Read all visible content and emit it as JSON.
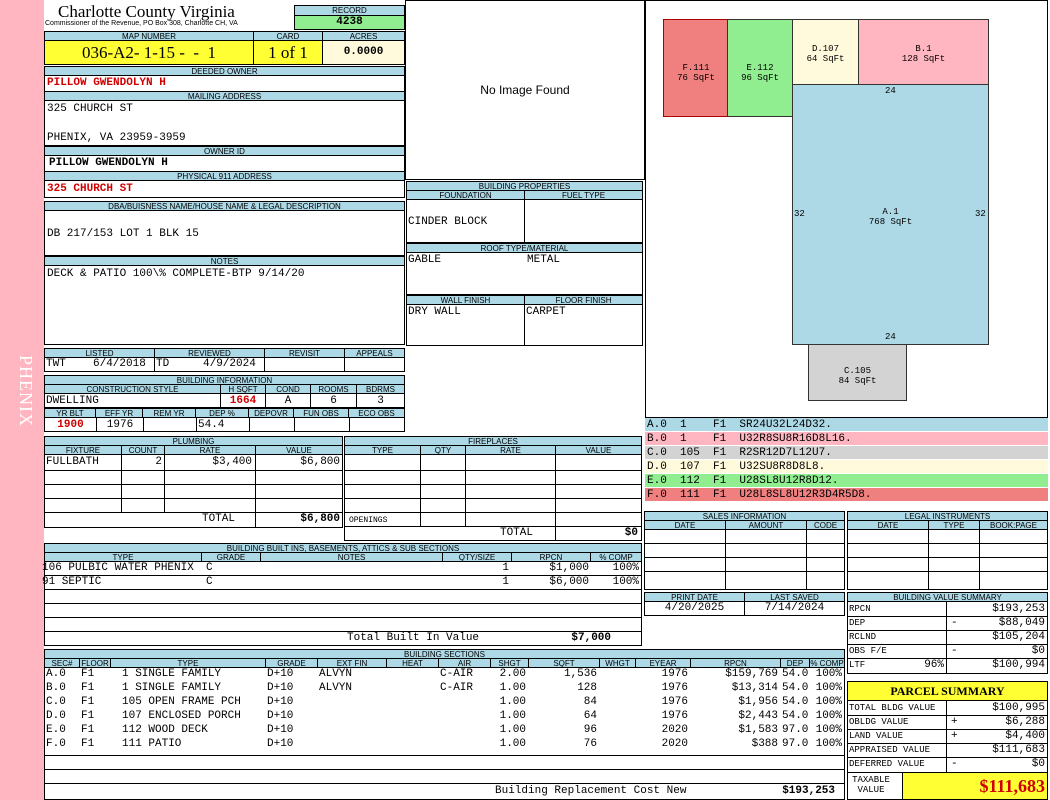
{
  "side_tab": "PHENIX",
  "county": {
    "title": "Charlotte County Virginia",
    "subtitle": "Commissioner of the Revenue, PO Box 308, Charlotte CH, VA"
  },
  "record": {
    "label": "RECORD",
    "value": "4238"
  },
  "map_number": {
    "label": "MAP NUMBER",
    "value": "036-A2- 1-15 -  -  1"
  },
  "card": {
    "label": "CARD",
    "value": "1 of 1"
  },
  "acres": {
    "label": "ACRES",
    "value": "0.0000"
  },
  "deeded_owner": {
    "label": "DEEDED OWNER",
    "value": "PILLOW GWENDOLYN H"
  },
  "mailing_address": {
    "label": "MAILING ADDRESS",
    "line1": "325 CHURCH ST",
    "line2": "PHENIX, VA 23959-3959"
  },
  "owner_id": {
    "label": "OWNER ID",
    "value": "PILLOW GWENDOLYN H"
  },
  "physical_address": {
    "label": "PHYSICAL 911 ADDRESS",
    "value": "325 CHURCH ST"
  },
  "dba": {
    "label": "DBA/BUISNESS NAME/HOUSE NAME & LEGAL DESCRIPTION",
    "value": "DB 217/153 LOT 1 BLK 15"
  },
  "notes": {
    "label": "NOTES",
    "value": "DECK & PATIO 100\\% COMPLETE-BTP 9/14/20"
  },
  "photo": {
    "text": "No Image Found"
  },
  "building_properties": {
    "label": "BUILDING PROPERTIES",
    "foundation_label": "FOUNDATION",
    "foundation": "CINDER BLOCK",
    "fuel_label": "FUEL TYPE",
    "fuel": "",
    "roof_label": "ROOF TYPE/MATERIAL",
    "roof_type": "GABLE",
    "roof_material": "METAL",
    "wall_label": "WALL FINISH",
    "wall": "DRY WALL",
    "floor_label": "FLOOR FINISH",
    "floor": "CARPET"
  },
  "review": {
    "listed_label": "LISTED",
    "listed_by": "TWT",
    "listed_date": "6/4/2018",
    "reviewed_label": "REVIEWED",
    "reviewed_by": "TD",
    "reviewed_date": "4/9/2024",
    "revisit_label": "REVISIT",
    "appeals_label": "APPEALS"
  },
  "building_info": {
    "label": "BUILDING INFORMATION",
    "headers": [
      "CONSTRUCTION STYLE",
      "H SQFT",
      "COND",
      "ROOMS",
      "BDRMS"
    ],
    "style": "DWELLING",
    "hsqft": "1664",
    "cond": "A",
    "rooms": "6",
    "bdrms": "3",
    "headers2": [
      "YR BLT",
      "EFF YR",
      "REM YR",
      "DEP %",
      "DEPOVR",
      "FUN OBS",
      "ECO OBS"
    ],
    "yr_blt": "1900",
    "eff_yr": "1976",
    "rem_yr": "",
    "dep": "54.4",
    "depovr": "",
    "fun_obs": "",
    "eco_obs": ""
  },
  "plumbing": {
    "label": "PLUMBING",
    "headers": [
      "FIXTURE",
      "COUNT",
      "RATE",
      "VALUE"
    ],
    "rows": [
      [
        "FULLBATH",
        "2",
        "$3,400",
        "$6,800"
      ]
    ],
    "total_label": "TOTAL",
    "total": "$6,800"
  },
  "fireplaces": {
    "label": "FIREPLACES",
    "headers": [
      "TYPE",
      "QTY",
      "RATE",
      "VALUE"
    ],
    "openings_label": "OPENINGS",
    "total_label": "TOTAL",
    "total": "$0"
  },
  "built_ins": {
    "label": "BUILDING BUILT INS, BASEMENTS, ATTICS & SUB SECTIONS",
    "headers": [
      "TYPE",
      "GRADE",
      "NOTES",
      "QTY/SIZE",
      "RPCN",
      "% COMP"
    ],
    "rows": [
      [
        "106 PULBIC WATER PHENIX",
        "C",
        "",
        "1",
        "$1,000",
        "100%"
      ],
      [
        "91 SEPTIC",
        "C",
        "",
        "1",
        "$6,000",
        "100%"
      ]
    ],
    "total_label": "Total Built In Value",
    "total": "$7,000"
  },
  "sketch": {
    "areas": [
      {
        "code": "F.111",
        "sqft": "76 SqFt",
        "color": "#f08080"
      },
      {
        "code": "E.112",
        "sqft": "96 SqFt",
        "color": "#90ee90"
      },
      {
        "code": "D.107",
        "sqft": "64 SqFt",
        "color": "#fffadc"
      },
      {
        "code": "B.1",
        "sqft": "128 SqFt",
        "color": "#ffb6c1"
      },
      {
        "code": "A.1",
        "sqft": "768 SqFt",
        "color": "#add8e6"
      },
      {
        "code": "C.105",
        "sqft": "84 SqFt",
        "color": "#d3d3d3"
      }
    ],
    "dims": {
      "top": "24",
      "left": "32",
      "right": "32",
      "bottom": "24"
    }
  },
  "legend": [
    {
      "text": "A.0  1    F1  SR24U32L24D32.",
      "color": "#add8e6"
    },
    {
      "text": "B.0  1    F1  U32R8SU8R16D8L16.",
      "color": "#ffb6c1"
    },
    {
      "text": "C.0  105  F1  R2SR12D7L12U7.",
      "color": "#d3d3d3"
    },
    {
      "text": "D.0  107  F1  U32SU8R8D8L8.",
      "color": "#fffadc"
    },
    {
      "text": "E.0  112  F1  U28SL8U12R8D12.",
      "color": "#90ee90"
    },
    {
      "text": "F.0  111  F1  U28L8SL8U12R3D4R5D8.",
      "color": "#f08080"
    }
  ],
  "sales": {
    "label": "SALES INFORMATION",
    "headers": [
      "DATE",
      "AMOUNT",
      "CODE"
    ]
  },
  "legal": {
    "label": "LEGAL INSTRUMENTS",
    "headers": [
      "DATE",
      "TYPE",
      "BOOK:PAGE"
    ]
  },
  "print_date": {
    "label": "PRINT DATE",
    "value": "4/20/2025"
  },
  "last_saved": {
    "label": "LAST SAVED",
    "value": "7/14/2024"
  },
  "value_summary": {
    "label": "BUILDING VALUE SUMMARY",
    "rows": [
      {
        "label": "RPCN",
        "sign": "",
        "value": "$193,253"
      },
      {
        "label": "DEP",
        "sign": "-",
        "value": "$88,049"
      },
      {
        "label": "RCLND",
        "sign": "",
        "value": "$105,204"
      },
      {
        "label": "OBS F/E",
        "sign": "-",
        "value": "$0"
      },
      {
        "label": "LTF",
        "sign": "96%",
        "value": "$100,994"
      }
    ]
  },
  "parcel_summary": {
    "label": "PARCEL SUMMARY",
    "rows": [
      {
        "label": "TOTAL BLDG VALUE",
        "sign": "",
        "value": "$100,995"
      },
      {
        "label": "OBLDG VALUE",
        "sign": "+",
        "value": "$6,288"
      },
      {
        "label": "LAND VALUE",
        "sign": "+",
        "value": "$4,400"
      },
      {
        "label": "APPRAISED VALUE",
        "sign": "",
        "value": "$111,683"
      },
      {
        "label": "DEFERRED VALUE",
        "sign": "-",
        "value": "$0"
      }
    ],
    "taxable_label": "TAXABLE VALUE",
    "taxable_value": "$111,683"
  },
  "building_sections": {
    "label": "BUILDING SECTIONS",
    "headers": [
      "SEC#",
      "FLOOR",
      "TYPE",
      "GRADE",
      "EXT FIN",
      "HEAT",
      "AIR",
      "SHGT",
      "SQFT",
      "WHGT",
      "EYEAR",
      "RPCN",
      "DEP",
      "% COMP"
    ],
    "rows": [
      [
        "A.0",
        "F1",
        "1 SINGLE FAMILY",
        "D+10",
        "ALVYN",
        "",
        "C-AIR",
        "2.00",
        "1,536",
        "",
        "1976",
        "$159,769",
        "54.0",
        "100%"
      ],
      [
        "B.0",
        "F1",
        "1 SINGLE FAMILY",
        "D+10",
        "ALVYN",
        "",
        "C-AIR",
        "1.00",
        "128",
        "",
        "1976",
        "$13,314",
        "54.0",
        "100%"
      ],
      [
        "C.0",
        "F1",
        "105 OPEN FRAME PCH",
        "D+10",
        "",
        "",
        "",
        "1.00",
        "84",
        "",
        "1976",
        "$1,956",
        "54.0",
        "100%"
      ],
      [
        "D.0",
        "F1",
        "107 ENCLOSED PORCH",
        "D+10",
        "",
        "",
        "",
        "1.00",
        "64",
        "",
        "1976",
        "$2,443",
        "54.0",
        "100%"
      ],
      [
        "E.0",
        "F1",
        "112 WOOD DECK",
        "D+10",
        "",
        "",
        "",
        "1.00",
        "96",
        "",
        "2020",
        "$1,583",
        "97.0",
        "100%"
      ],
      [
        "F.0",
        "F1",
        "111 PATIO",
        "D+10",
        "",
        "",
        "",
        "1.00",
        "76",
        "",
        "2020",
        "$388",
        "97.0",
        "100%"
      ]
    ],
    "replacement_label": "Building Replacement Cost New",
    "replacement_value": "$193,253"
  }
}
